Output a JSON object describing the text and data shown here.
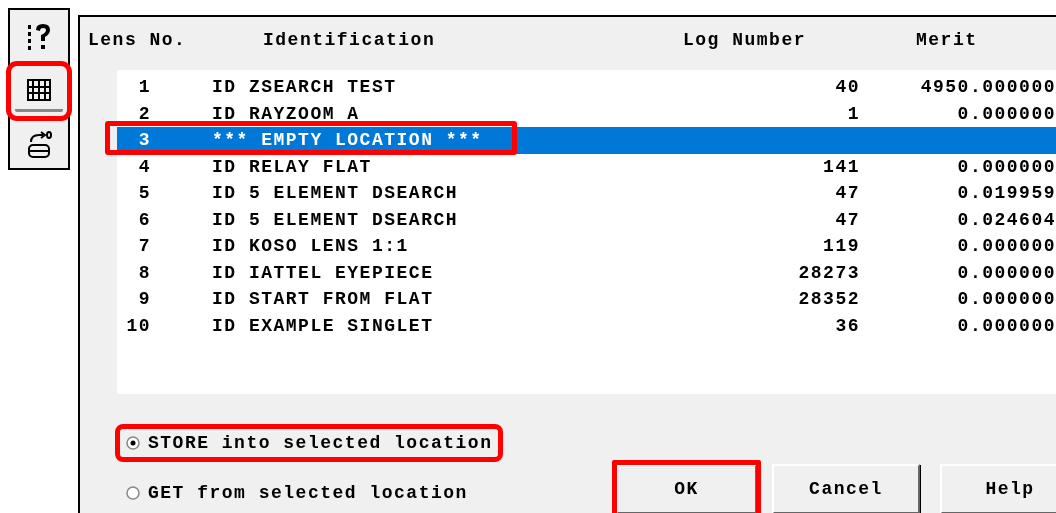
{
  "toolbar": [
    {
      "kind": "help",
      "highlighted": false
    },
    {
      "kind": "library",
      "highlighted": true
    },
    {
      "kind": "store",
      "highlighted": false
    }
  ],
  "columns": [
    "Lens No.",
    "Identification",
    "Log Number",
    "Merit"
  ],
  "rows": [
    {
      "number": "1",
      "identification": "ID ZSEARCH TEST",
      "log_number": "40",
      "merit": "4950.000000",
      "selected": false,
      "highlighted": false
    },
    {
      "number": "2",
      "identification": "ID RAYZOOM A",
      "log_number": "1",
      "merit": "0.000000",
      "selected": false,
      "highlighted": false
    },
    {
      "number": "3",
      "identification": "*** EMPTY LOCATION ***",
      "selected": true,
      "highlighted": true
    },
    {
      "number": "4",
      "identification": "ID RELAY FLAT",
      "log_number": "141",
      "merit": "0.000000",
      "selected": false,
      "highlighted": false
    },
    {
      "number": "5",
      "identification": "ID 5 ELEMENT DSEARCH",
      "log_number": "47",
      "merit": "0.019959",
      "selected": false,
      "highlighted": false
    },
    {
      "number": "6",
      "identification": "ID 5 ELEMENT DSEARCH",
      "log_number": "47",
      "merit": "0.024604",
      "selected": false,
      "highlighted": false
    },
    {
      "number": "7",
      "identification": "ID KOSO LENS 1:1",
      "log_number": "119",
      "merit": "0.000000",
      "selected": false,
      "highlighted": false
    },
    {
      "number": "8",
      "identification": "ID IATTEL EYEPIECE",
      "log_number": "28273",
      "merit": "0.000000",
      "selected": false,
      "highlighted": false
    },
    {
      "number": "9",
      "identification": "ID START FROM FLAT",
      "log_number": "28352",
      "merit": "0.000000",
      "selected": false,
      "highlighted": false
    },
    {
      "number": "10",
      "identification": "ID EXAMPLE SINGLET",
      "log_number": "36",
      "merit": "0.000000",
      "selected": false,
      "highlighted": false
    }
  ],
  "options": [
    {
      "label": "STORE into selected location",
      "selected": true,
      "highlighted": true
    },
    {
      "label": "GET from selected location",
      "selected": false,
      "highlighted": false
    }
  ],
  "buttons": [
    {
      "label": "OK",
      "highlighted": true
    },
    {
      "label": "Cancel",
      "highlighted": false
    },
    {
      "label": "Help",
      "highlighted": false
    }
  ]
}
